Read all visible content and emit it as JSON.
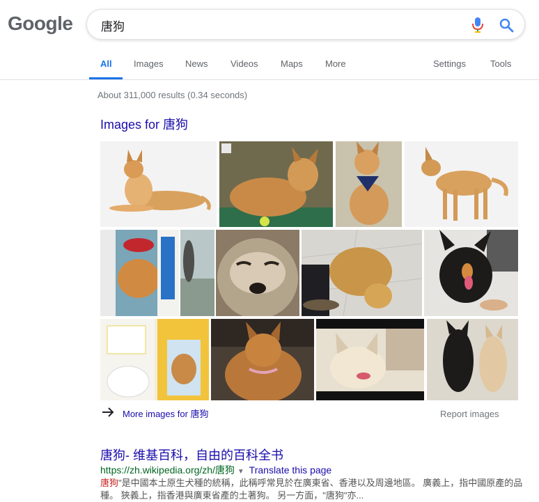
{
  "logo": "Google",
  "search": {
    "query": "唐狗"
  },
  "tabs": {
    "all": "All",
    "images": "Images",
    "news": "News",
    "videos": "Videos",
    "maps": "Maps",
    "more": "More",
    "settings": "Settings",
    "tools": "Tools"
  },
  "result_stats": "About 311,000 results (0.34 seconds)",
  "images_section": {
    "heading": "Images for 唐狗",
    "more_images": "More images for 唐狗",
    "report_images": "Report images"
  },
  "result": {
    "title": "唐狗- 维基百科，自由的百科全书",
    "url": "https://zh.wikipedia.org/zh/唐狗",
    "translate": "Translate this page",
    "snippet_em": "唐狗",
    "snippet_rest": "\"是中國本土原生犬種的統稱，此稱呼常見於在廣東省、香港以及周邊地區。 廣義上，指中國原產的品種。 狹義上，指香港與廣東省產的土著狗。 另一方面，\"唐狗\"亦..."
  },
  "colors": {
    "accent_blue": "#1a73e8",
    "link_blue": "#1a0dab",
    "url_green": "#006621",
    "mic_red": "#ea4335",
    "snippet_highlight": "#c5221f"
  },
  "icons": [
    "mic-icon",
    "search-icon",
    "arrow-right-icon"
  ]
}
